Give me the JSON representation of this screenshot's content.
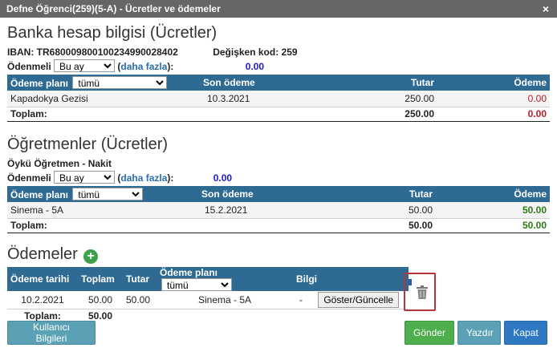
{
  "window": {
    "title": "Defne Öğrenci(259)(5-A) - Ücretler ve ödemeler",
    "close_label": "×"
  },
  "bank": {
    "heading": "Banka hesap bilgisi (Ücretler)",
    "iban": "IBAN: TR680009800100234990028402",
    "variable_code": "Değişken kod: 259",
    "payable_label": "Ödenmeli",
    "payable_select": "Bu ay",
    "more_open": "(",
    "more_link": "daha fazla",
    "more_close": "):",
    "payable_amount": "0.00",
    "table": {
      "headers": [
        "Ödeme planı",
        "Son ödeme",
        "Tutar",
        "Ödeme"
      ],
      "plan_select": "tümü",
      "rows": [
        {
          "plan": "Kapadokya Gezisi",
          "due": "10.3.2021",
          "amount": "250.00",
          "paid": "0.00"
        }
      ],
      "total_label": "Toplam:",
      "total_amount": "250.00",
      "total_paid": "0.00"
    }
  },
  "teachers": {
    "heading": "Öğretmenler (Ücretler)",
    "subtitle": "Öykü Öğretmen - Nakit",
    "payable_label": "Ödenmeli",
    "payable_select": "Bu ay",
    "more_open": "(",
    "more_link": "daha fazla",
    "more_close": "):",
    "payable_amount": "0.00",
    "table": {
      "headers": [
        "Ödeme planı",
        "Son ödeme",
        "Tutar",
        "Ödeme"
      ],
      "plan_select": "tümü",
      "rows": [
        {
          "plan": "Sinema - 5A",
          "due": "15.2.2021",
          "amount": "50.00",
          "paid": "50.00"
        }
      ],
      "total_label": "Toplam:",
      "total_amount": "50.00",
      "total_paid": "50.00"
    }
  },
  "payments": {
    "heading": "Ödemeler",
    "add_icon": "plus-icon",
    "headers": [
      "Ödeme tarihi",
      "Toplam",
      "Tutar",
      "Ödeme planı",
      "Bilgi"
    ],
    "plan_select": "tümü",
    "rows": [
      {
        "date": "10.2.2021",
        "total": "50.00",
        "amount": "50.00",
        "plan": "Sinema - 5A",
        "info": "-",
        "action": "Göster/Güncelle"
      }
    ],
    "total_label": "Toplam:",
    "total_value": "50.00"
  },
  "footer": {
    "user_info": "Kullanıcı Bilgileri",
    "send": "Gönder",
    "print": "Yazdır",
    "close": "Kapat"
  },
  "colors": {
    "header_bg": "#2e6a92",
    "titlebar_bg": "#666666",
    "send_green": "#4cae4c",
    "print_teal": "#5aa1b5",
    "close_blue": "#2f79c2",
    "highlight_red": "#b5363a"
  }
}
